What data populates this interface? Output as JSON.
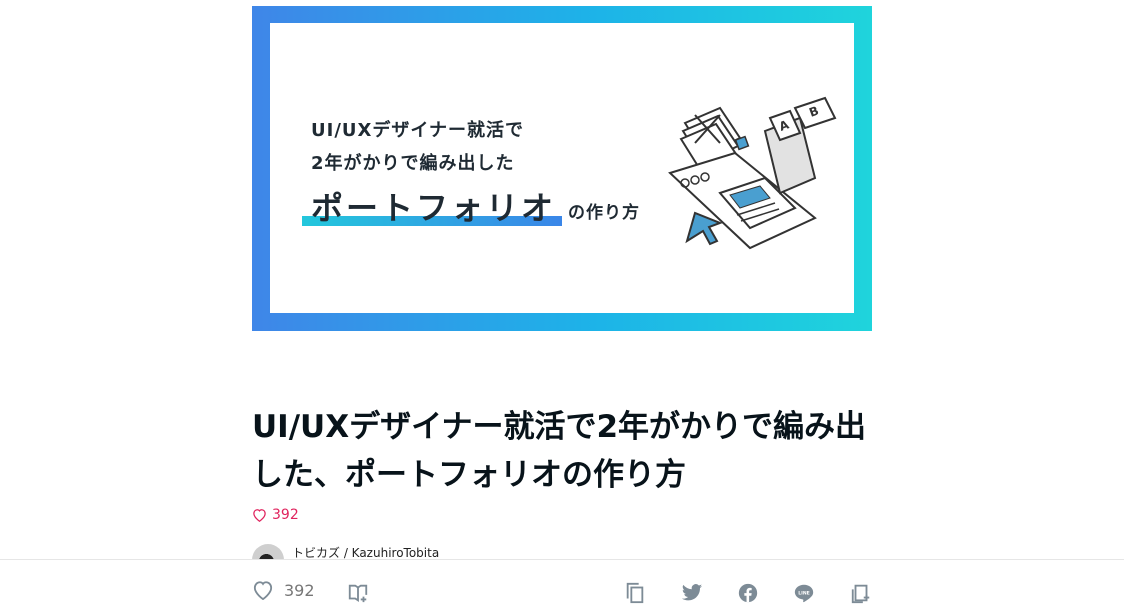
{
  "hero": {
    "line1": "UI/UXデザイナー就活で",
    "line2": "2年がかりで編み出した",
    "line3": "ポートフォリオ",
    "line3_suffix": "の作り方",
    "illustration_letters": [
      "A",
      "B"
    ]
  },
  "article": {
    "title": "UI/UXデザイナー就活で2年がかりで編み出した、ポートフォリオの作り方",
    "likes": "392",
    "author": "トビカズ / KazuhiroTobita"
  },
  "bottom_bar": {
    "likes": "392",
    "icons": [
      "heart-icon",
      "magazine-add-icon",
      "copy-link-icon",
      "twitter-icon",
      "facebook-icon",
      "line-icon",
      "embed-icon"
    ]
  },
  "colors": {
    "gradient_start": "#3f86e8",
    "gradient_end": "#1fd4dc",
    "like_accent": "#e0245e"
  }
}
